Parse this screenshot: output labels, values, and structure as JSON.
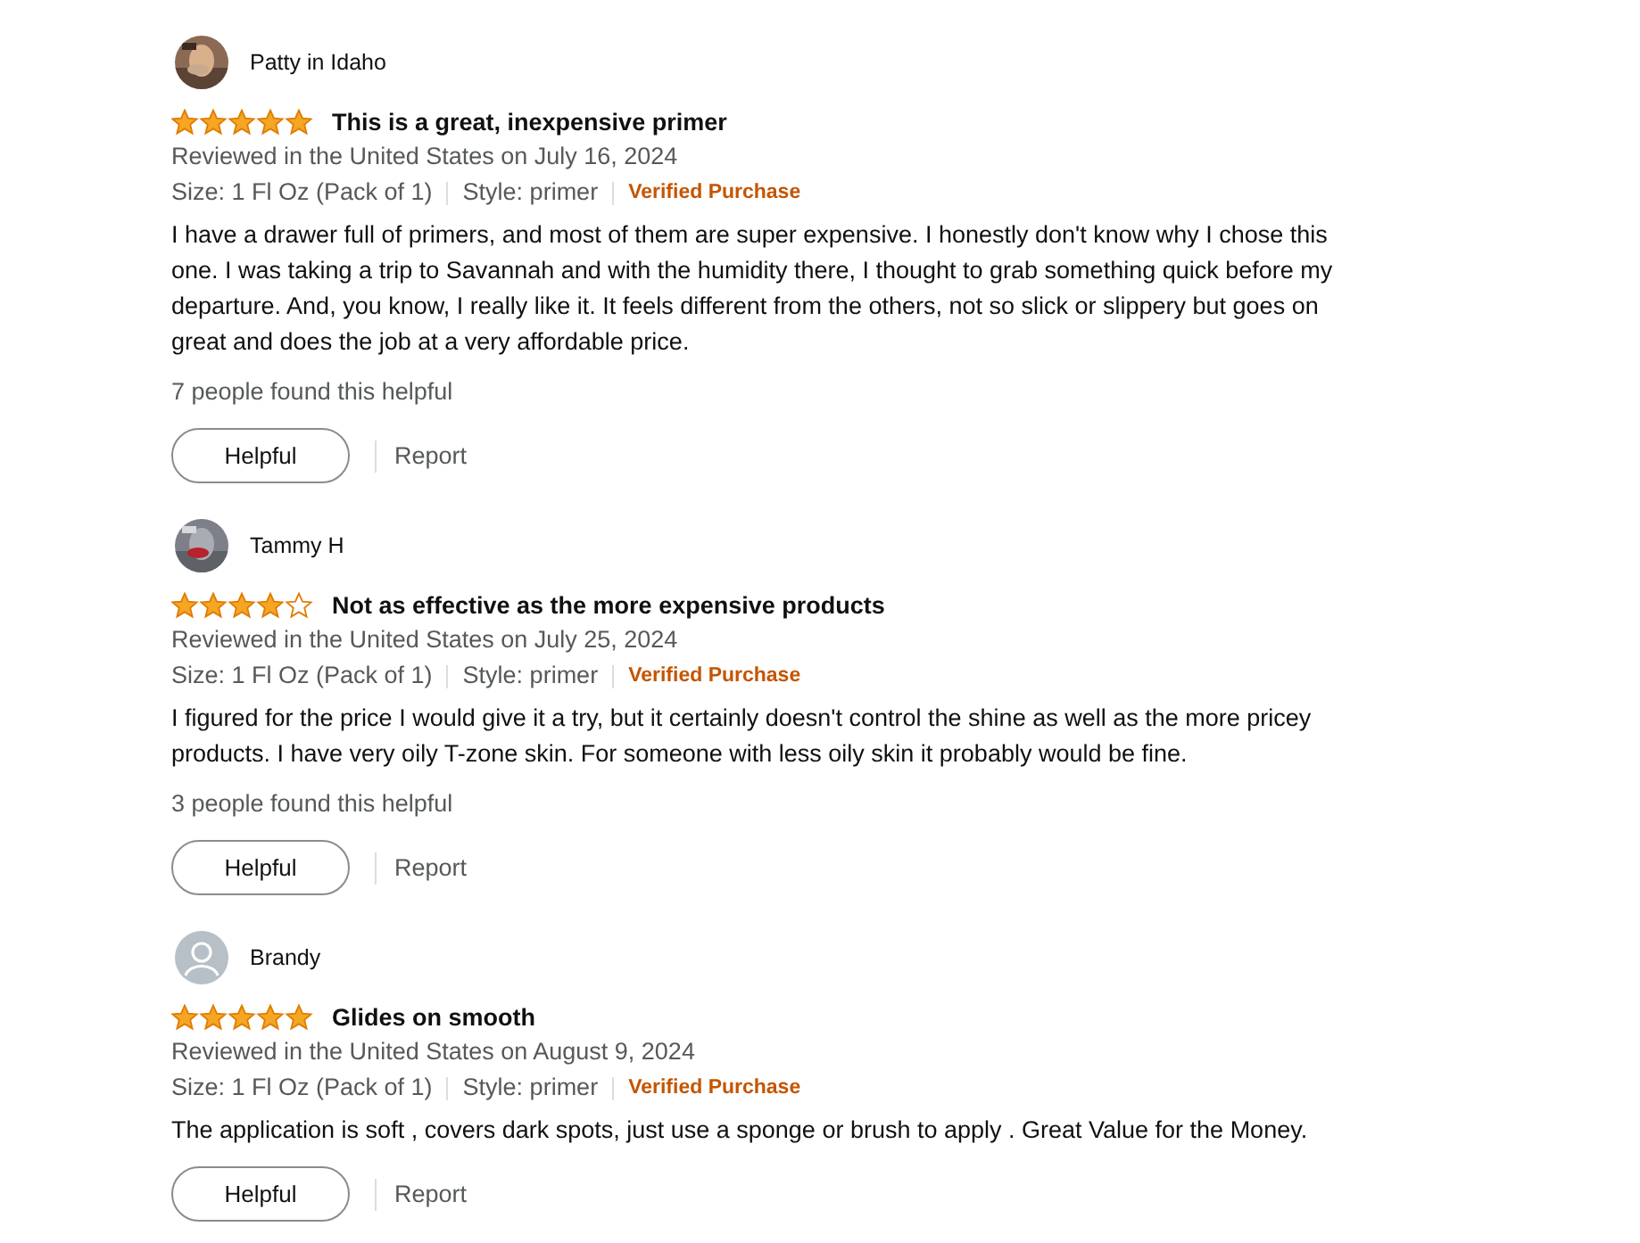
{
  "reviews": [
    {
      "author": "Patty in Idaho",
      "stars": 5,
      "title": "This is a great, inexpensive primer",
      "date": "Reviewed in the United States on July 16, 2024",
      "size": "Size: 1 Fl Oz (Pack of 1)",
      "style": "Style: primer",
      "badge": "Verified Purchase",
      "body": "I have a drawer full of primers, and most of them are super expensive. I honestly don't know why I chose this one. I was taking a trip to Savannah and with the humidity there, I thought to grab something quick before my departure. And, you know, I really like it. It feels different from the others, not so slick or slippery but goes on great and does the job at a very affordable price.",
      "helpful_count": "7 people found this helpful",
      "helpful_button": "Helpful",
      "report": "Report"
    },
    {
      "author": "Tammy H",
      "stars": 4,
      "title": "Not as effective as the more expensive products",
      "date": "Reviewed in the United States on July 25, 2024",
      "size": "Size: 1 Fl Oz (Pack of 1)",
      "style": "Style: primer",
      "badge": "Verified Purchase",
      "body": "I figured for the price I would give it a try, but it certainly doesn't control the shine as well as the more pricey products. I have very oily T-zone skin. For someone with less oily skin it probably would be fine.",
      "helpful_count": "3 people found this helpful",
      "helpful_button": "Helpful",
      "report": "Report"
    },
    {
      "author": "Brandy",
      "avatar": {
        "kind": "default"
      },
      "stars": 5,
      "title": "Glides on smooth",
      "date": "Reviewed in the United States on August 9, 2024",
      "size": "Size: 1 Fl Oz (Pack of 1)",
      "style": "Style: primer",
      "badge": "Verified Purchase",
      "body": "The application is soft , covers dark spots, just use a sponge or brush to apply . Great Value for the Money.",
      "helpful_button": "Helpful",
      "report": "Report"
    }
  ]
}
